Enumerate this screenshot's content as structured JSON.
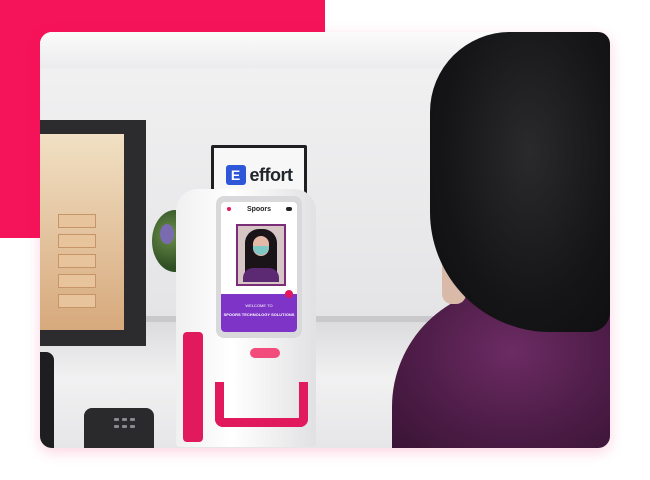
{
  "scene": {
    "accent_color": "#f5135a",
    "kiosk_accent": "#e01a5c"
  },
  "wall_sign": {
    "logo_icon": "effort-logo-icon",
    "logo_glyph": "E",
    "text": "effort"
  },
  "kiosk_screen": {
    "brand": "Spoors",
    "welcome_line1": "WELCOME TO",
    "welcome_line2": "SPOORS TECHNOLOGY SOLUTIONS",
    "welcome_bar_color": "#7e34c7"
  }
}
